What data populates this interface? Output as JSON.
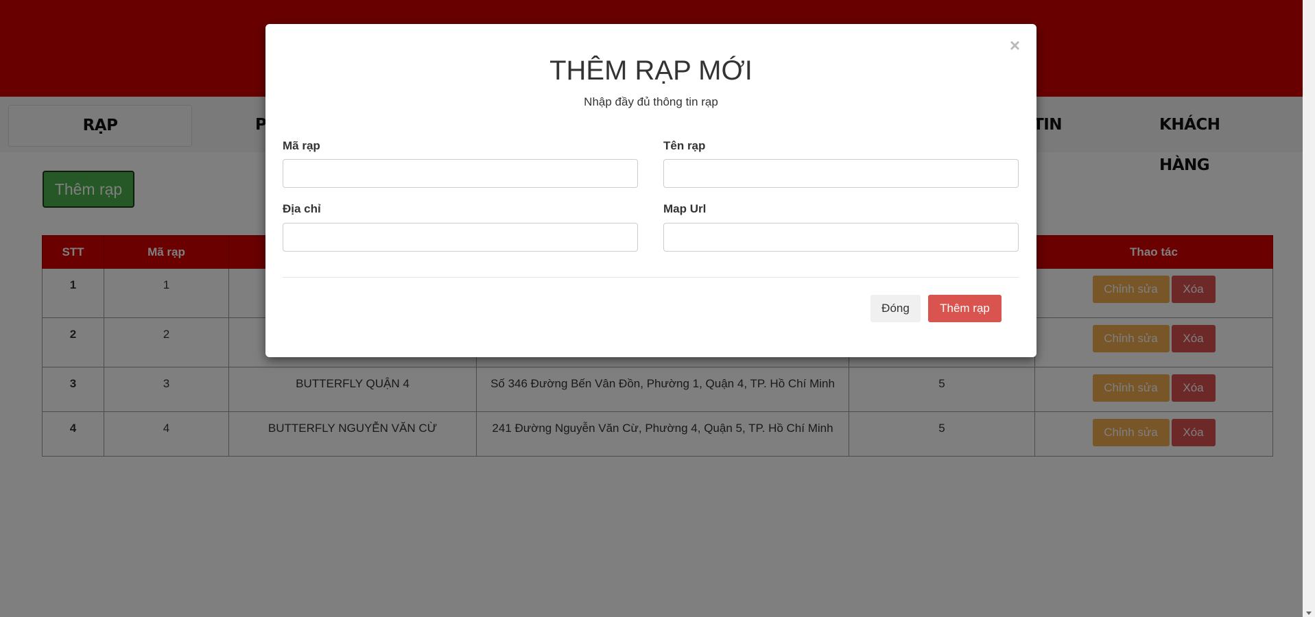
{
  "nav": {
    "items": [
      {
        "label": "RẠP"
      },
      {
        "label": "P"
      },
      {
        "label": "TIN"
      },
      {
        "label": "KHÁCH HÀNG"
      }
    ]
  },
  "main": {
    "add_button": "Thêm rạp"
  },
  "table": {
    "headers": [
      "STT",
      "Mã rạp",
      "",
      "",
      "",
      "Thao tác"
    ],
    "rows": [
      {
        "stt": "1",
        "ma": "1",
        "ten": "",
        "dia_chi": "",
        "so": "",
        "edit": "Chỉnh sửa",
        "delete": "Xóa"
      },
      {
        "stt": "2",
        "ma": "2",
        "ten": "",
        "dia_chi": "",
        "so": "",
        "edit": "Chỉnh sửa",
        "delete": "Xóa"
      },
      {
        "stt": "3",
        "ma": "3",
        "ten": "BUTTERFLY QUẬN 4",
        "dia_chi": "Số 346 Đường Bến Vân Đồn, Phường 1, Quận 4, TP. Hồ Chí Minh",
        "so": "5",
        "edit": "Chỉnh sửa",
        "delete": "Xóa"
      },
      {
        "stt": "4",
        "ma": "4",
        "ten": "BUTTERFLY NGUYỄN VĂN CỪ",
        "dia_chi": "241 Đường Nguyễn Văn Cừ, Phường 4, Quận 5, TP. Hồ Chí Minh",
        "so": "5",
        "edit": "Chỉnh sửa",
        "delete": "Xóa"
      }
    ]
  },
  "modal": {
    "close_symbol": "×",
    "title": "THÊM RẠP MỚI",
    "subtitle": "Nhập đầy đủ thông tin rạp",
    "fields": {
      "ma_rap": {
        "label": "Mã rạp",
        "value": ""
      },
      "ten_rap": {
        "label": "Tên rạp",
        "value": ""
      },
      "dia_chi": {
        "label": "Địa chỉ",
        "value": ""
      },
      "map_url": {
        "label": "Map Url",
        "value": ""
      }
    },
    "close_button": "Đóng",
    "submit_button": "Thêm rạp"
  },
  "colors": {
    "brand_red": "#d20000",
    "success_green": "#4cae4c",
    "warning_orange": "#f0ad4e",
    "danger_red": "#d9534f"
  }
}
